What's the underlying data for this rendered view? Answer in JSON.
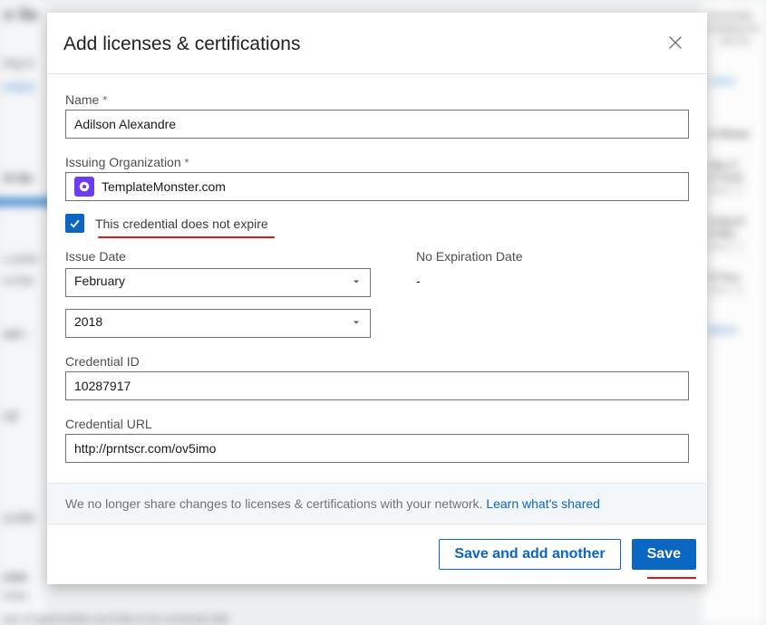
{
  "modal": {
    "title": "Add licenses & certifications",
    "fields": {
      "name": {
        "label": "Name",
        "required": "*",
        "value": "Adilson Alexandre"
      },
      "org": {
        "label": "Issuing Organization",
        "required": "*",
        "value": "TemplateMonster.com"
      },
      "no_expire": {
        "label": "This credential does not expire"
      },
      "issue": {
        "label": "Issue Date",
        "month": "February",
        "year": "2018"
      },
      "expire": {
        "label": "No Expiration Date",
        "dash": "-"
      },
      "cred_id": {
        "label": "Credential ID",
        "value": "10287917"
      },
      "cred_url": {
        "label": "Credential URL",
        "value": "http://prntscr.com/ov5imo"
      }
    },
    "share_notice": "We no longer share changes to licenses & certifications with your network. ",
    "share_link": "Learn what's shared",
    "buttons": {
      "save_another": "Save and add another",
      "save": "Save"
    }
  },
  "background": {
    "right_top_1": "Essential reading for",
    "right_top_2": "not no",
    "right_link_1": "t your",
    "right_mid_1": "h these",
    "right_item_a1": "obe X",
    "right_item_a2": "d Trick",
    "right_item_a3": "wers: 2",
    "right_item_b1": "roducti",
    "right_item_b2": "d Mix",
    "right_item_b3": "wers: 2",
    "right_item_c1": "O Fou",
    "right_item_c3": "wers: 5",
    "right_link_2": "ations",
    "left_1": "o Se",
    "left_2": "ting S",
    "left_link": "ection",
    "left_3": "th Be",
    "left_4": "u work",
    "left_5": "re the",
    "left_6": "ext  ›",
    "left_7": "rd",
    "left_8": "profile",
    "left_9": "ests",
    "left_10": "know",
    "left_11": "pes of opportunities you'd like to be connected with"
  }
}
